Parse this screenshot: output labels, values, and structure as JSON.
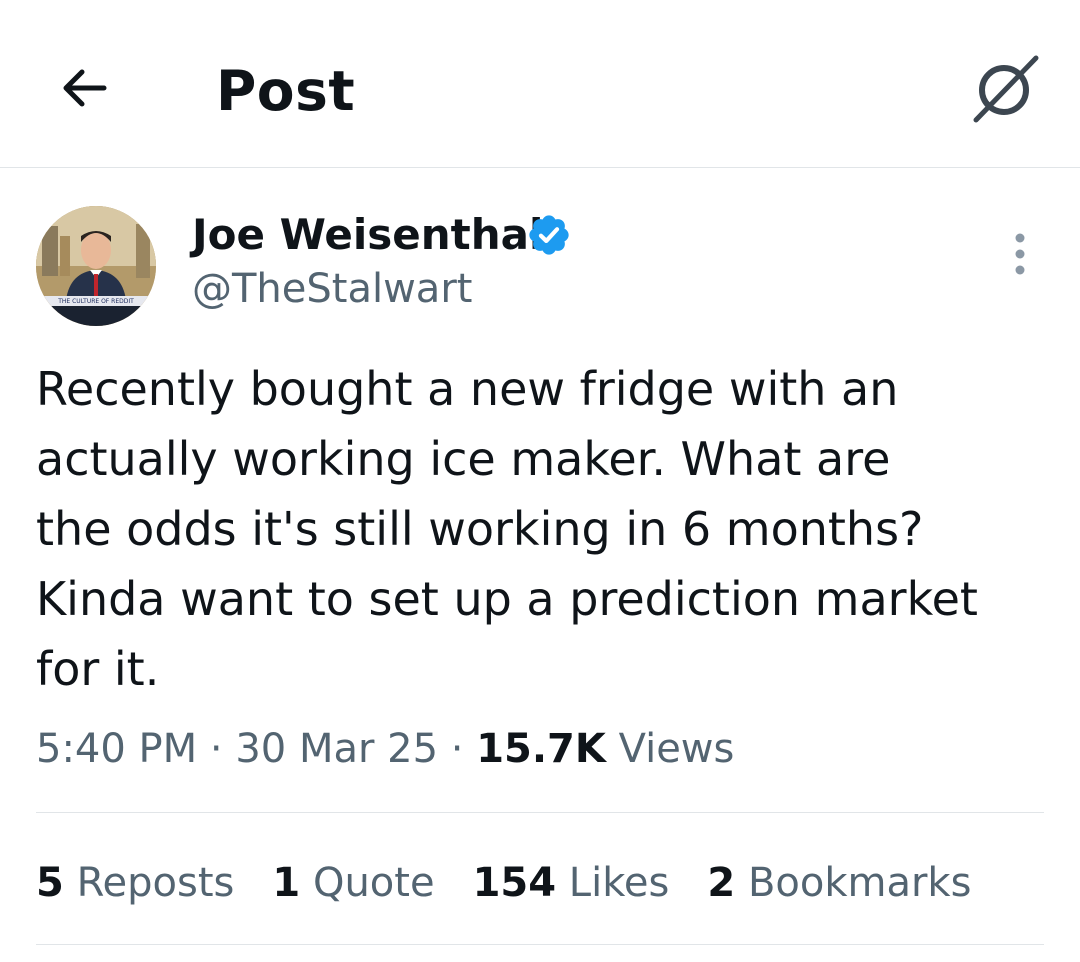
{
  "header": {
    "title": "Post",
    "back_icon": "arrow-left-icon",
    "grok_icon": "grok-icon"
  },
  "author": {
    "name": "Joe Weisenthal",
    "handle": "@TheStalwart",
    "verified": true,
    "verified_color": "#1d9bf0",
    "avatar_caption": "THE CULTURE OF REDDIT"
  },
  "post": {
    "text": "Recently bought a new fridge with an\nactually working ice maker. What are\nthe odds it's still working in 6 months?\nKinda want to set up a prediction market\nfor it.",
    "time": "5:40 PM",
    "date": "30 Mar 25",
    "separator": "·",
    "views_count": "15.7K",
    "views_label": "Views"
  },
  "stats": [
    {
      "count": "5",
      "label": "Reposts"
    },
    {
      "count": "1",
      "label": "Quote"
    },
    {
      "count": "154",
      "label": "Likes"
    },
    {
      "count": "2",
      "label": "Bookmarks"
    }
  ],
  "colors": {
    "text_primary": "#0f1419",
    "text_secondary": "#536471",
    "divider": "#e1e5e8"
  }
}
